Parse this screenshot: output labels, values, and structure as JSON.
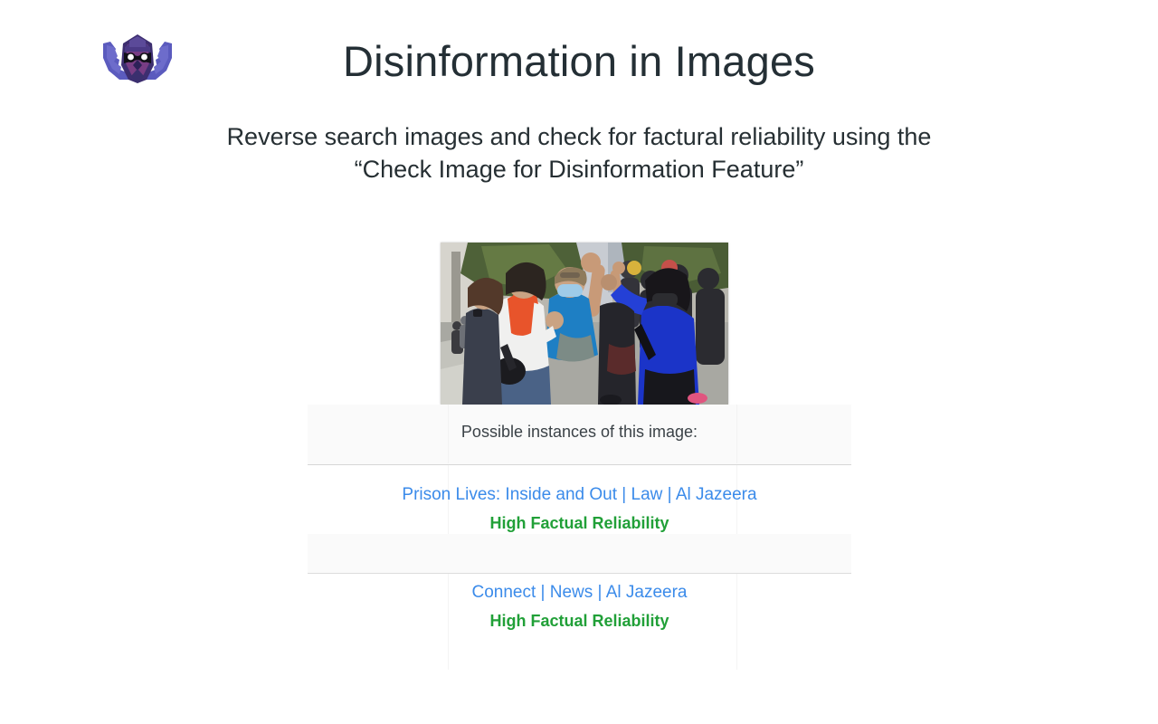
{
  "slide": {
    "title": "Disinformation in Images",
    "subtitle_line1": "Reverse search images and check for factural reliability using the",
    "subtitle_line2": "“Check Image for Disinformation Feature”",
    "logo_icon": "owl-logo-icon",
    "colors": {
      "title": "#242f35",
      "subtitle": "#262f33",
      "link": "#3b8bea",
      "reliability": "#21a038",
      "band_background": "#fafafa",
      "divider": "#dcdcdc",
      "logo_wing": "#5b5bbe",
      "logo_body": "#3d2e70",
      "logo_accent": "#7d3f85"
    }
  },
  "app": {
    "image_alt": "protest-crowd-photo",
    "instances_label": "Possible instances of this image:",
    "results": [
      {
        "link_text": "Prison Lives: Inside and Out | Law | Al Jazeera",
        "reliability": "High Factual Reliability"
      },
      {
        "link_text": "Connect | News | Al Jazeera",
        "reliability": "High Factual Reliability"
      }
    ]
  }
}
